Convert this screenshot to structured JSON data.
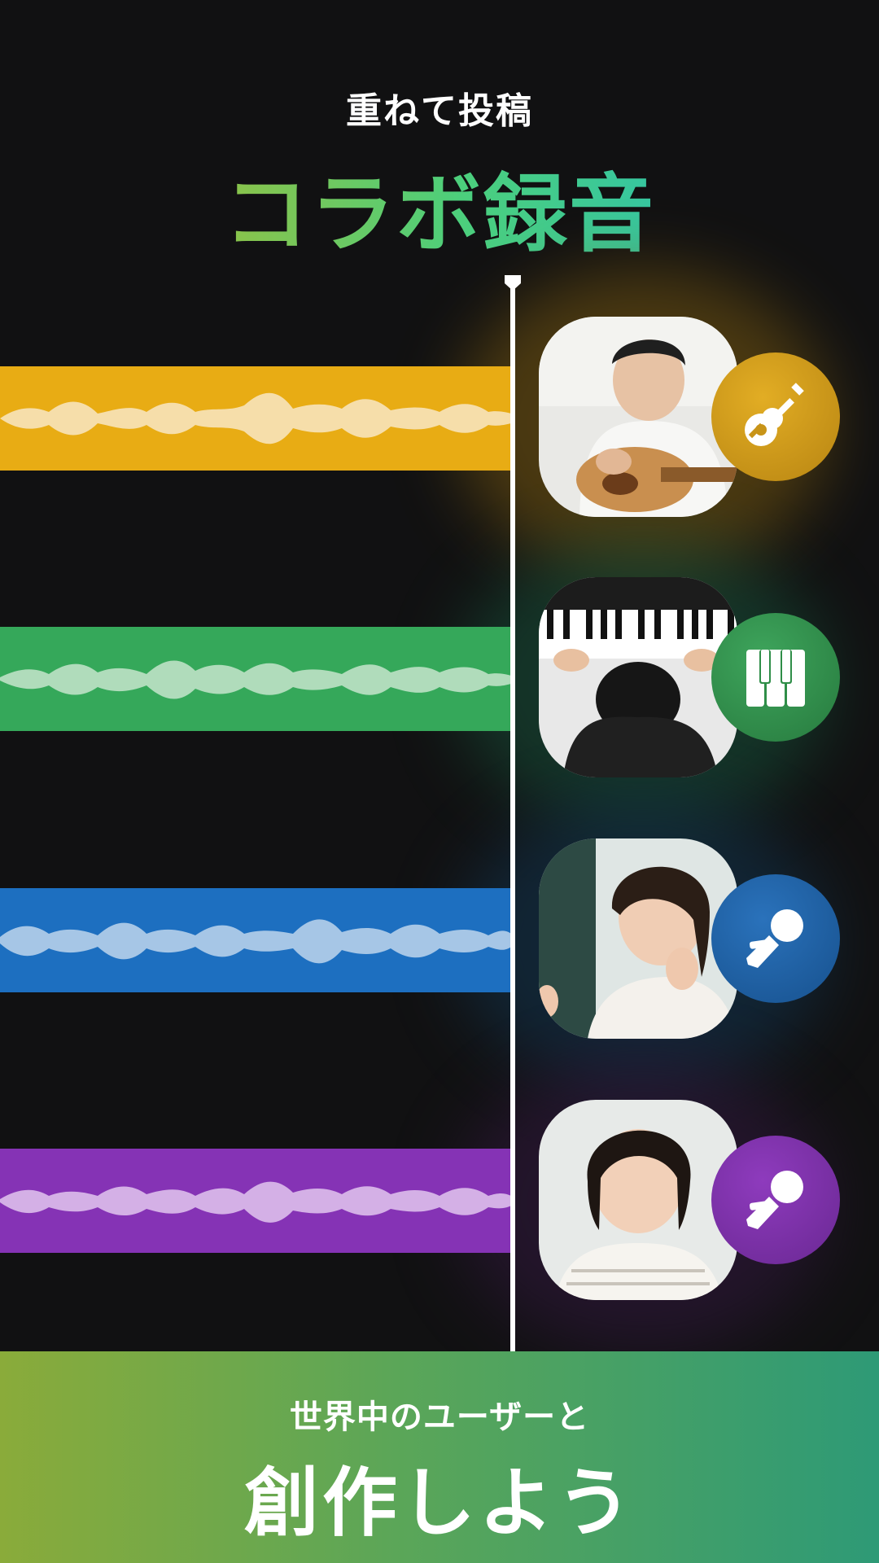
{
  "header": {
    "subtitle": "重ねて投稿",
    "title": "コラボ録音"
  },
  "tracks": [
    {
      "instrument": "guitar",
      "color": "#e8ac14",
      "wave_color": "#f6deaa",
      "icon": "guitar-icon",
      "badge_color": "#c89418",
      "glow_color": "#8a6a10"
    },
    {
      "instrument": "piano",
      "color": "#35a85a",
      "wave_color": "#b0dcbb",
      "icon": "piano-keys-icon",
      "badge_color": "#2f8e48",
      "glow_color": "#1e6a3a"
    },
    {
      "instrument": "vocal",
      "color": "#1d6fc0",
      "wave_color": "#a6c6e6",
      "icon": "microphone-icon",
      "badge_color": "#1b5ea5",
      "glow_color": "#17406a"
    },
    {
      "instrument": "vocal",
      "color": "#8533b5",
      "wave_color": "#d4b0e6",
      "icon": "microphone-icon",
      "badge_color": "#7b2fa8",
      "glow_color": "#44205c"
    }
  ],
  "footer": {
    "subtitle": "世界中のユーザーと",
    "title": "創作しよう"
  }
}
